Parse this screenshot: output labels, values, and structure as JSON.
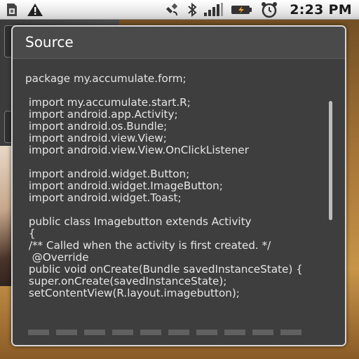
{
  "status_bar": {
    "time": "2:23 PM",
    "icons": [
      "sim-card-icon",
      "warning-icon",
      "satellite-icon",
      "bluetooth-icon",
      "signal-icon",
      "battery-icon",
      "alarm-icon"
    ]
  },
  "dialog": {
    "title": "Source",
    "code_lines": [
      "package my.accumulate.form;",
      "",
      " import my.accumulate.start.R;",
      " import android.app.Activity;",
      " import android.os.Bundle;",
      " import android.view.View;",
      " import android.view.View.OnClickListener",
      "",
      " import android.widget.Button;",
      " import android.widget.ImageButton;",
      " import android.widget.Toast;",
      "",
      " public class Imagebutton extends Activity",
      " {",
      " /** Called when the activity is first created. */",
      "  @Override",
      " public void onCreate(Bundle savedInstanceState) {",
      " super.onCreate(savedInstanceState);",
      " setContentView(R.layout.imagebutton);"
    ]
  },
  "colors": {
    "dialog_bg": "#3e3e3e",
    "dialog_border": "#d8d8d8",
    "text": "#e6e6e6"
  }
}
